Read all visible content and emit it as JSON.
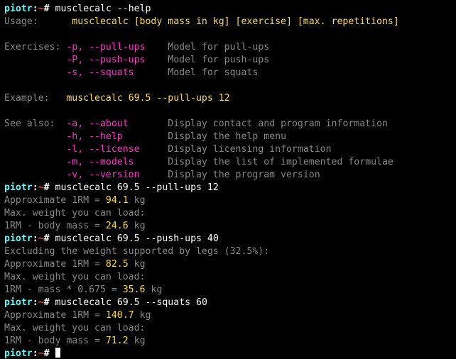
{
  "prompt_user": "piotr",
  "prompt_sep": ":",
  "prompt_path": "~",
  "prompt_hash": "# ",
  "cmd1": "musclecalc --help",
  "help": {
    "usage_label": "Usage:",
    "usage_pad": "      ",
    "usage_cmd": "musclecalc [body mass in kg] [exercise] [max. repetitions]",
    "ex_label": "Exercises:",
    "ex": [
      {
        "pad": " ",
        "flag": "-p, --pull-ups",
        "gap": "    ",
        "desc": "Model for pull-ups"
      },
      {
        "pad": "           ",
        "flag": "-P, --push-ups",
        "gap": "    ",
        "desc": "Model for push-ups"
      },
      {
        "pad": "           ",
        "flag": "-s, --squats",
        "gap": "      ",
        "desc": "Model for squats"
      }
    ],
    "example_label": "Example:",
    "example_pad": "   ",
    "example_cmd": "musclecalc 69.5 --pull-ups 12",
    "see_label": "See also:",
    "see": [
      {
        "pad": "  ",
        "flag": "-a, --about",
        "gap": "       ",
        "desc": "Display contact and program information"
      },
      {
        "pad": "           ",
        "flag": "-h, --help",
        "gap": "        ",
        "desc": "Display the help menu"
      },
      {
        "pad": "           ",
        "flag": "-l, --license",
        "gap": "     ",
        "desc": "Display licensing information"
      },
      {
        "pad": "           ",
        "flag": "-m, --models",
        "gap": "      ",
        "desc": "Display the list of implemented formulae"
      },
      {
        "pad": "           ",
        "flag": "-v, --version",
        "gap": "     ",
        "desc": "Display the program version"
      }
    ]
  },
  "runs": [
    {
      "cmd_prog": "musclecalc ",
      "cmd_mass": "69.5",
      "cmd_mid": " --pull-ups ",
      "cmd_reps": "12",
      "approx_label": "Approximate 1RM = ",
      "approx_val": "94.1",
      "approx_unit": " kg",
      "load_label": "Max. weight you can load:",
      "formula_lhs": "1RM - body mass = ",
      "formula_val": "24.6",
      "formula_unit": " kg"
    },
    {
      "cmd_prog": "musclecalc ",
      "cmd_mass": "69.5",
      "cmd_mid": " --push-ups ",
      "cmd_reps": "40",
      "extra_line": "Excluding the weight supported by legs (32.5%):",
      "approx_label": "Approximate 1RM = ",
      "approx_val": "82.5",
      "approx_unit": " kg",
      "load_label": "Max. weight you can load:",
      "formula_lhs": "1RM - mass * 0.675 = ",
      "formula_val": "35.6",
      "formula_unit": " kg"
    },
    {
      "cmd_prog": "musclecalc ",
      "cmd_mass": "69.5",
      "cmd_mid": " --squats ",
      "cmd_reps": "60",
      "approx_label": "Approximate 1RM = ",
      "approx_val": "140.7",
      "approx_unit": " kg",
      "load_label": "Max. weight you can load:",
      "formula_lhs": "1RM - body mass = ",
      "formula_val": "71.2",
      "formula_unit": " kg"
    }
  ]
}
